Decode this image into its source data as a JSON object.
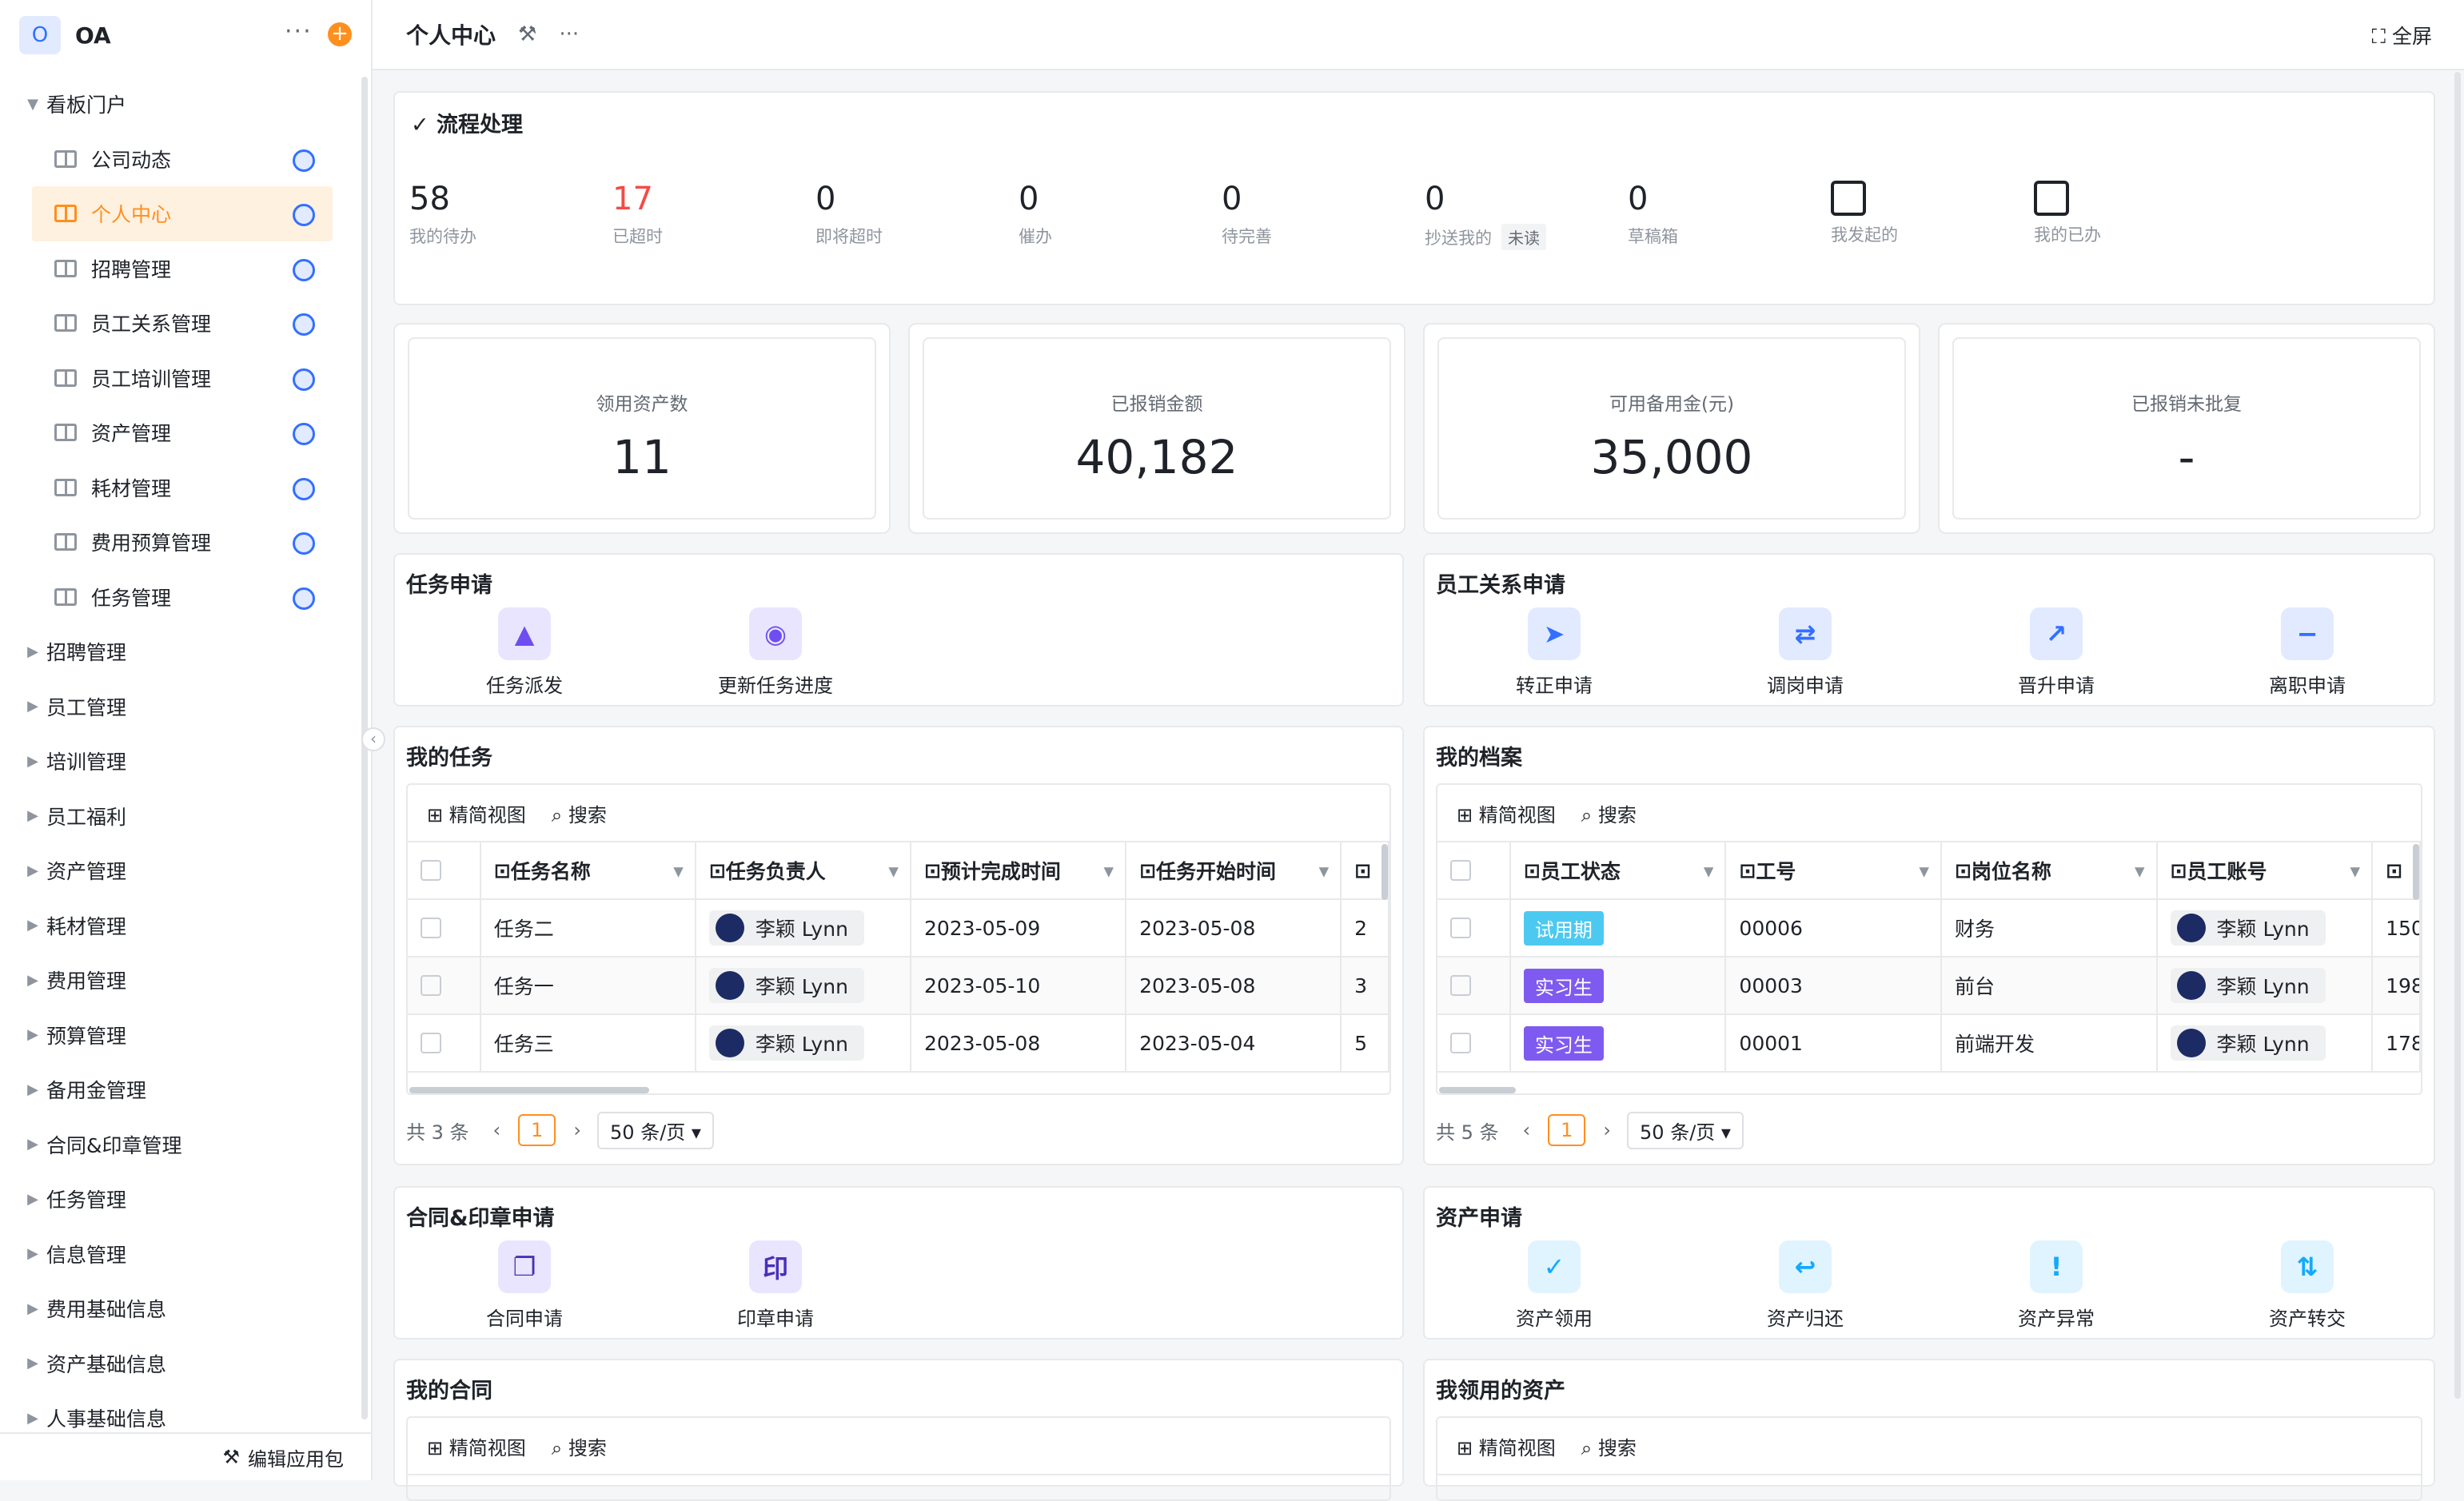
{
  "app": {
    "logo": "O",
    "name": "OA",
    "more": "···",
    "add": "+"
  },
  "sidebar": {
    "groups": [
      {
        "label": "看板门户",
        "expanded": true,
        "children": [
          {
            "label": "公司动态"
          },
          {
            "label": "个人中心",
            "active": true
          },
          {
            "label": "招聘管理"
          },
          {
            "label": "员工关系管理"
          },
          {
            "label": "员工培训管理"
          },
          {
            "label": "资产管理"
          },
          {
            "label": "耗材管理"
          },
          {
            "label": "费用预算管理"
          },
          {
            "label": "任务管理"
          }
        ]
      },
      {
        "label": "招聘管理"
      },
      {
        "label": "员工管理"
      },
      {
        "label": "培训管理"
      },
      {
        "label": "员工福利"
      },
      {
        "label": "资产管理"
      },
      {
        "label": "耗材管理"
      },
      {
        "label": "费用管理"
      },
      {
        "label": "预算管理"
      },
      {
        "label": "备用金管理"
      },
      {
        "label": "合同&印章管理"
      },
      {
        "label": "任务管理"
      },
      {
        "label": "信息管理"
      },
      {
        "label": "费用基础信息"
      },
      {
        "label": "资产基础信息"
      },
      {
        "label": "人事基础信息"
      }
    ],
    "footer": "编辑应用包"
  },
  "topbar": {
    "title": "个人中心",
    "fullscreen": "全屏"
  },
  "flow": {
    "title": "流程处理",
    "stats": [
      {
        "num": "58",
        "label": "我的待办"
      },
      {
        "num": "17",
        "label": "已超时",
        "red": true
      },
      {
        "num": "0",
        "label": "即将超时"
      },
      {
        "num": "0",
        "label": "催办"
      },
      {
        "num": "0",
        "label": "待完善"
      },
      {
        "num": "0",
        "label": "抄送我的",
        "tag": "未读"
      },
      {
        "num": "0",
        "label": "草稿箱"
      },
      {
        "icon": "doc-plus-icon",
        "label": "我发起的"
      },
      {
        "icon": "calendar-check-icon",
        "label": "我的已办"
      }
    ]
  },
  "metrics": [
    {
      "label": "领用资产数",
      "value": "11"
    },
    {
      "label": "已报销金额",
      "value": "40,182"
    },
    {
      "label": "可用备用金(元)",
      "value": "35,000"
    },
    {
      "label": "已报销未批复",
      "value": "-"
    }
  ],
  "task_apply": {
    "title": "任务申请",
    "entries": [
      {
        "label": "任务派发",
        "glyph": "▲",
        "icon": "navigate-icon",
        "bg": "#e9e5ff",
        "fg": "#6e4df1"
      },
      {
        "label": "更新任务进度",
        "glyph": "◉",
        "icon": "progress-icon",
        "bg": "#e9e5ff",
        "fg": "#6e4df1"
      }
    ]
  },
  "staff_apply": {
    "title": "员工关系申请",
    "entries": [
      {
        "label": "转正申请",
        "glyph": "➤",
        "icon": "send-icon",
        "bg": "#e1eaff",
        "fg": "#3370ff"
      },
      {
        "label": "调岗申请",
        "glyph": "⇄",
        "icon": "transfer-icon",
        "bg": "#e1eaff",
        "fg": "#3370ff"
      },
      {
        "label": "晋升申请",
        "glyph": "↗",
        "icon": "trend-up-icon",
        "bg": "#e1eaff",
        "fg": "#3370ff"
      },
      {
        "label": "离职申请",
        "glyph": "−",
        "icon": "user-minus-icon",
        "bg": "#e1eaff",
        "fg": "#3370ff"
      }
    ]
  },
  "my_tasks": {
    "title": "我的任务",
    "tools": {
      "view": "精简视图",
      "search": "搜索"
    },
    "columns": [
      "任务名称",
      "任务负责人",
      "预计完成时间",
      "任务开始时间"
    ],
    "rows": [
      {
        "name": "任务二",
        "owner": "李颖 Lynn",
        "due": "2023-05-09",
        "start": "2023-05-08",
        "extra": "2"
      },
      {
        "name": "任务一",
        "owner": "李颖 Lynn",
        "due": "2023-05-10",
        "start": "2023-05-08",
        "extra": "3"
      },
      {
        "name": "任务三",
        "owner": "李颖 Lynn",
        "due": "2023-05-08",
        "start": "2023-05-04",
        "extra": "5"
      }
    ],
    "pager": {
      "total": "共 3 条",
      "page": "1",
      "size": "50 条/页"
    }
  },
  "my_archive": {
    "title": "我的档案",
    "tools": {
      "view": "精简视图",
      "search": "搜索"
    },
    "columns": [
      "员工状态",
      "工号",
      "岗位名称",
      "员工账号"
    ],
    "rows": [
      {
        "status": "试用期",
        "color": "#4cc9f0",
        "id": "00006",
        "post": "财务",
        "account": "李颖 Lynn",
        "extra": "150"
      },
      {
        "status": "实习生",
        "color": "#7f5af0",
        "id": "00003",
        "post": "前台",
        "account": "李颖 Lynn",
        "extra": "198"
      },
      {
        "status": "实习生",
        "color": "#7f5af0",
        "id": "00001",
        "post": "前端开发",
        "account": "李颖 Lynn",
        "extra": "178"
      }
    ],
    "pager": {
      "total": "共 5 条",
      "page": "1",
      "size": "50 条/页"
    }
  },
  "contract_apply": {
    "title": "合同&印章申请",
    "entries": [
      {
        "label": "合同申请",
        "glyph": "❐",
        "icon": "copy-icon",
        "bg": "#e9e5ff",
        "fg": "#4a2fb8"
      },
      {
        "label": "印章申请",
        "glyph": "印",
        "icon": "seal-icon",
        "bg": "#e9e5ff",
        "fg": "#4a2fb8"
      }
    ]
  },
  "asset_apply": {
    "title": "资产申请",
    "entries": [
      {
        "label": "资产领用",
        "glyph": "✓",
        "icon": "clipboard-check-icon",
        "bg": "#e0f4ff",
        "fg": "#14a9ff"
      },
      {
        "label": "资产归还",
        "glyph": "↩",
        "icon": "clipboard-return-icon",
        "bg": "#e0f4ff",
        "fg": "#14a9ff"
      },
      {
        "label": "资产异常",
        "glyph": "!",
        "icon": "warning-icon",
        "bg": "#e0f4ff",
        "fg": "#14a9ff"
      },
      {
        "label": "资产转交",
        "glyph": "⇅",
        "icon": "swap-icon",
        "bg": "#e0f4ff",
        "fg": "#14a9ff"
      }
    ]
  },
  "my_contracts": {
    "title": "我的合同",
    "tools": {
      "view": "精简视图",
      "search": "搜索"
    }
  },
  "my_assets": {
    "title": "我领用的资产",
    "tools": {
      "view": "精简视图",
      "search": "搜索"
    }
  }
}
